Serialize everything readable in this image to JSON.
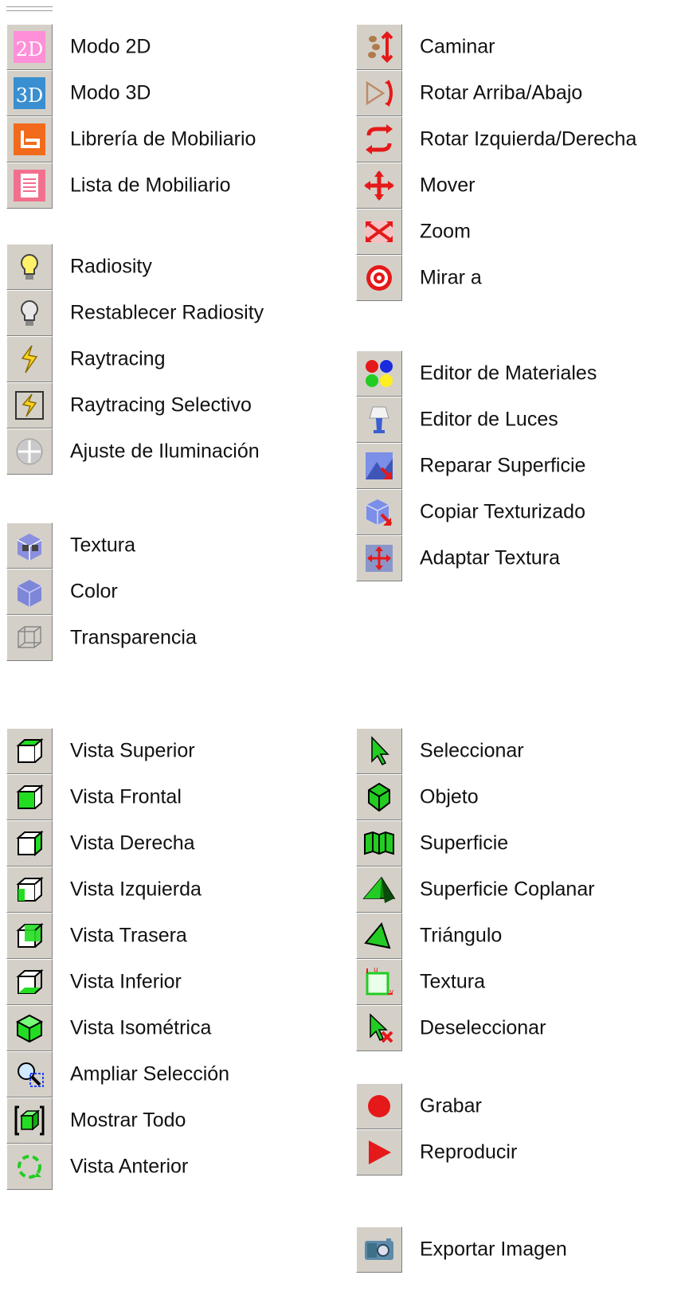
{
  "groups": [
    {
      "id": "view-mode",
      "items": [
        {
          "label": "Modo 2D",
          "icon": "mode-2d-icon"
        },
        {
          "label": "Modo 3D",
          "icon": "mode-3d-icon"
        },
        {
          "label": "Librería de Mobiliario",
          "icon": "furniture-library-icon"
        },
        {
          "label": "Lista de Mobiliario",
          "icon": "furniture-list-icon"
        }
      ]
    },
    {
      "id": "lighting",
      "items": [
        {
          "label": "Radiosity",
          "icon": "lightbulb-on-icon"
        },
        {
          "label": "Restablecer Radiosity",
          "icon": "lightbulb-off-icon"
        },
        {
          "label": "Raytracing",
          "icon": "lightning-icon"
        },
        {
          "label": "Raytracing Selectivo",
          "icon": "lightning-selective-icon"
        },
        {
          "label": "Ajuste de Iluminación",
          "icon": "light-adjust-icon"
        }
      ]
    },
    {
      "id": "render",
      "items": [
        {
          "label": "Textura",
          "icon": "texture-cube-icon"
        },
        {
          "label": "Color",
          "icon": "color-cube-icon"
        },
        {
          "label": "Transparencia",
          "icon": "wireframe-cube-icon"
        }
      ]
    },
    {
      "id": "views",
      "items": [
        {
          "label": "Vista Superior",
          "icon": "view-top-icon"
        },
        {
          "label": "Vista Frontal",
          "icon": "view-front-icon"
        },
        {
          "label": "Vista Derecha",
          "icon": "view-right-icon"
        },
        {
          "label": "Vista Izquierda",
          "icon": "view-left-icon"
        },
        {
          "label": "Vista Trasera",
          "icon": "view-back-icon"
        },
        {
          "label": "Vista Inferior",
          "icon": "view-bottom-icon"
        },
        {
          "label": "Vista Isométrica",
          "icon": "view-isometric-icon"
        },
        {
          "label": "Ampliar Selección",
          "icon": "zoom-selection-icon"
        },
        {
          "label": "Mostrar Todo",
          "icon": "show-all-icon"
        },
        {
          "label": "Vista Anterior",
          "icon": "previous-view-icon"
        }
      ]
    },
    {
      "id": "navigation",
      "items": [
        {
          "label": "Caminar",
          "icon": "walk-icon"
        },
        {
          "label": "Rotar Arriba/Abajo",
          "icon": "rotate-updown-icon"
        },
        {
          "label": "Rotar Izquierda/Derecha",
          "icon": "rotate-leftright-icon"
        },
        {
          "label": "Mover",
          "icon": "move-icon"
        },
        {
          "label": "Zoom",
          "icon": "zoom-icon"
        },
        {
          "label": "Mirar a",
          "icon": "look-at-icon"
        }
      ]
    },
    {
      "id": "materials",
      "items": [
        {
          "label": "Editor de Materiales",
          "icon": "material-editor-icon"
        },
        {
          "label": "Editor de Luces",
          "icon": "light-editor-icon"
        },
        {
          "label": "Reparar Superficie",
          "icon": "repair-surface-icon"
        },
        {
          "label": "Copiar Texturizado",
          "icon": "copy-texture-icon"
        },
        {
          "label": "Adaptar Textura",
          "icon": "fit-texture-icon"
        }
      ]
    },
    {
      "id": "selection",
      "items": [
        {
          "label": "Seleccionar",
          "icon": "select-arrow-icon"
        },
        {
          "label": "Objeto",
          "icon": "object-icon"
        },
        {
          "label": "Superficie",
          "icon": "surface-icon"
        },
        {
          "label": "Superficie Coplanar",
          "icon": "coplanar-surface-icon"
        },
        {
          "label": "Triángulo",
          "icon": "triangle-icon"
        },
        {
          "label": "Textura",
          "icon": "texture-uv-icon"
        },
        {
          "label": "Deseleccionar",
          "icon": "deselect-icon"
        }
      ]
    },
    {
      "id": "record",
      "items": [
        {
          "label": "Grabar",
          "icon": "record-icon"
        },
        {
          "label": "Reproducir",
          "icon": "play-icon"
        }
      ]
    },
    {
      "id": "export",
      "items": [
        {
          "label": "Exportar Imagen",
          "icon": "camera-icon"
        }
      ]
    }
  ]
}
